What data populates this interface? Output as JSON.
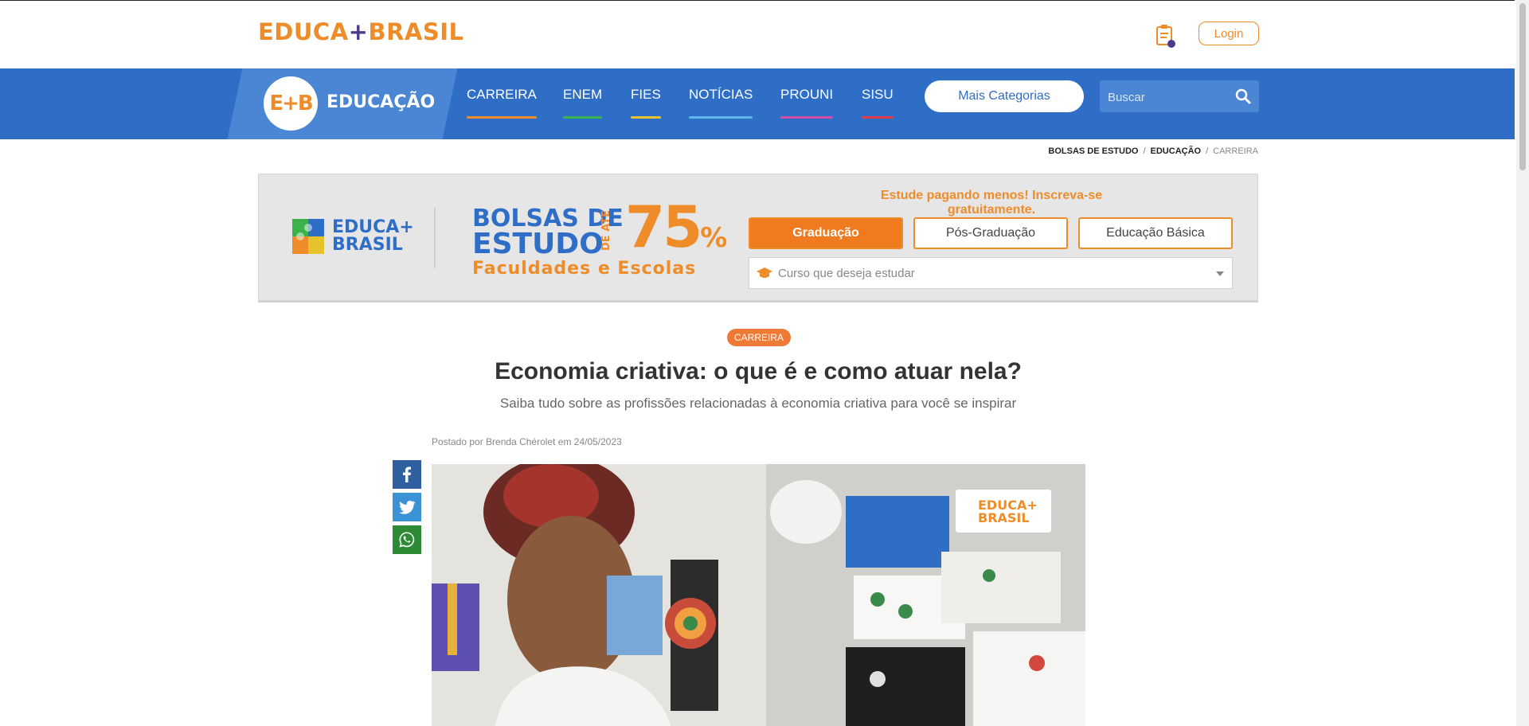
{
  "header": {
    "logo_text_left": "EDUCA",
    "logo_plus": "+",
    "logo_text_right": "BRASIL",
    "login_label": "Login"
  },
  "navbar": {
    "badge_text": "E+B",
    "section_title": "EDUCAÇÃO",
    "links": [
      {
        "label": "CARREIRA",
        "color": "#ef8c2a"
      },
      {
        "label": "ENEM",
        "color": "#3bb34a"
      },
      {
        "label": "FIES",
        "color": "#e6c32b"
      },
      {
        "label": "NOTÍCIAS",
        "color": "#5bb6ec"
      },
      {
        "label": "PROUNI",
        "color": "#d14fa8"
      },
      {
        "label": "SISU",
        "color": "#e23b4a"
      }
    ],
    "categories_label": "Mais Categorias",
    "search_placeholder": "Buscar"
  },
  "breadcrumb": {
    "items": [
      "BOLSAS DE ESTUDO",
      "EDUCAÇÃO",
      "CARREIRA"
    ]
  },
  "promo": {
    "logo_line1": "EDUCA+",
    "logo_line2": "BRASIL",
    "title_line1": "BOLSAS DE",
    "title_line2": "ESTUDO",
    "de_ate": "DE ATÉ",
    "percent": "75",
    "percent_sign": "%",
    "subtitle": "Faculdades e Escolas",
    "cta": "Estude pagando menos! Inscreva-se gratuitamente.",
    "tabs": [
      "Graduação",
      "Pós-Graduação",
      "Educação Básica"
    ],
    "active_tab": "Graduação",
    "course_placeholder": "Curso que deseja estudar"
  },
  "article": {
    "category": "CARREIRA",
    "title": "Economia criativa: o que é e como atuar nela?",
    "subtitle": "Saiba tudo sobre as profissões relacionadas à economia criativa para você se inspirar",
    "posted": "Postado por Brenda Chérolet em 24/05/2023",
    "hero_watermark_line1": "EDUCA+",
    "hero_watermark_line2": "BRASIL"
  },
  "colors": {
    "brand_orange": "#ef8c2a",
    "brand_blue": "#2f6ec6"
  }
}
